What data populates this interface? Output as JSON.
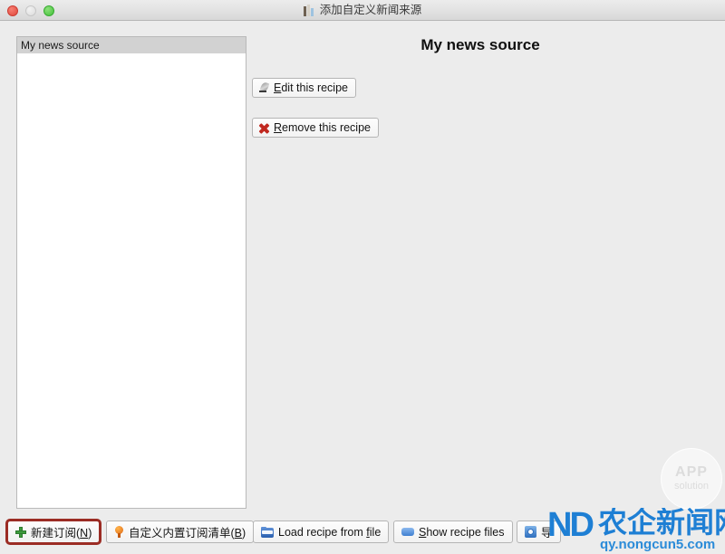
{
  "titlebar": {
    "title": "添加自定义新闻来源",
    "icon": "books-icon",
    "close_label": "",
    "minimize_label": "",
    "maximize_label": ""
  },
  "list_panel": {
    "items": [
      {
        "label": "My news source",
        "selected": true
      }
    ]
  },
  "detail": {
    "title": "My news source",
    "edit_button": {
      "prefix": "",
      "accel": "E",
      "suffix": "dit this recipe",
      "icon": "quill-icon"
    },
    "remove_button": {
      "prefix": "",
      "accel": "R",
      "suffix": "emove this recipe",
      "icon": "red-x-icon"
    }
  },
  "toolbar": {
    "new_subscription": {
      "prefix": "新建订阅(",
      "accel": "N",
      "suffix": ")",
      "icon": "green-plus-icon",
      "focused": true
    },
    "custom_builtin": {
      "prefix": "自定义内置订阅清单(",
      "accel": "B",
      "suffix": ")",
      "icon": "lightbulb-icon"
    },
    "load_recipe": {
      "prefix": "Load recipe from ",
      "accel": "f",
      "suffix": "ile",
      "icon": "blue-folder-icon"
    },
    "show_recipe_files": {
      "prefix": "",
      "accel": "S",
      "suffix": "how recipe files",
      "icon": "blue-block-icon"
    },
    "export": {
      "prefix": "导",
      "accel": "",
      "suffix": "",
      "icon": "disc-icon"
    }
  },
  "watermarks": {
    "app_solution": {
      "main": "APP",
      "sub": "solution"
    },
    "brand": {
      "mark": "ND",
      "name": "农企新闻网",
      "url": "qy.nongcun5.com"
    }
  },
  "colors": {
    "window_bg": "#ececec",
    "focus_outline": "#9b2c24",
    "selection_bg": "#d2d2d2",
    "brand_blue": "#1e7fd4"
  }
}
